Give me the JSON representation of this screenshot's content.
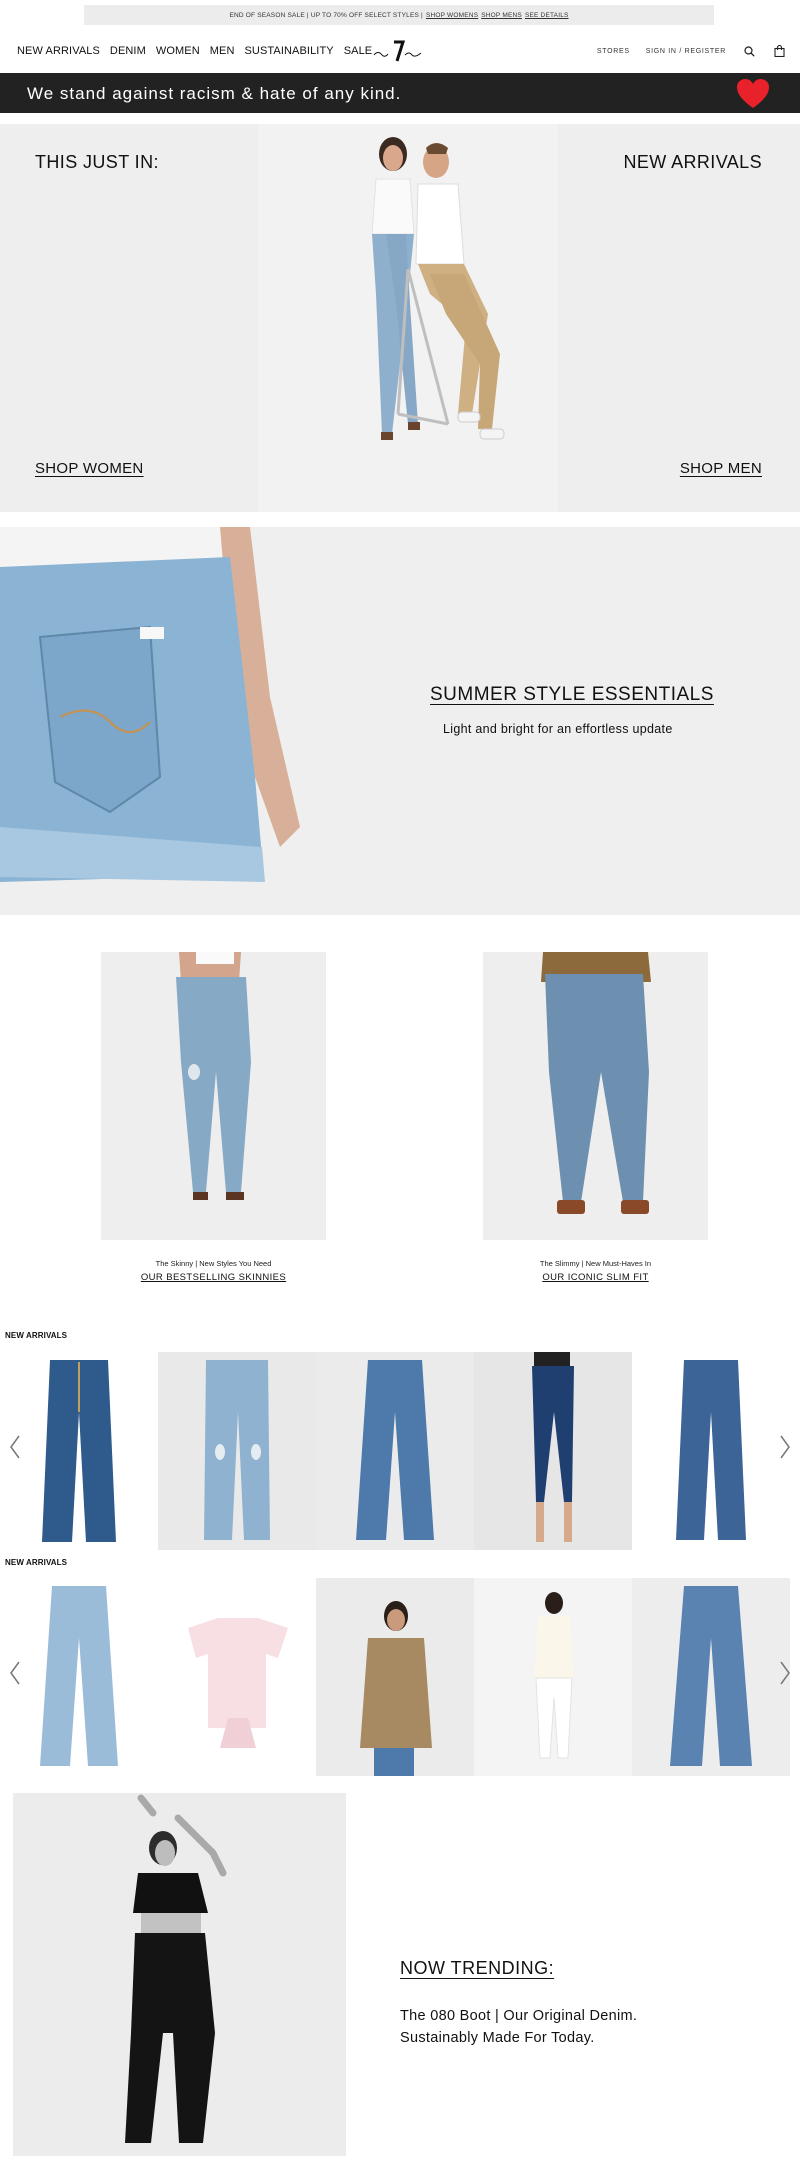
{
  "promo": {
    "text": "END OF SEASON SALE | UP TO 70% OFF SELECT STYLES |",
    "link_women": "SHOP WOMENS",
    "link_men": "SHOP MENS",
    "link_details": "SEE DETAILS"
  },
  "nav": {
    "items": [
      "NEW ARRIVALS",
      "DENIM",
      "WOMEN",
      "MEN",
      "SUSTAINABILITY",
      "SALE"
    ],
    "stores": "STORES",
    "signin": "SIGN IN / REGISTER"
  },
  "banner": {
    "text": "We stand against racism & hate of any kind."
  },
  "hero": {
    "left_title": "THIS JUST IN:",
    "right_title": "NEW ARRIVALS",
    "shop_women": "SHOP WOMEN",
    "shop_men": "SHOP MEN"
  },
  "summer": {
    "heading": "SUMMER STYLE ESSENTIALS",
    "subheading": "Light and bright for an effortless update"
  },
  "features": [
    {
      "caption": "The Skinny | New Styles You Need",
      "link": "OUR BESTSELLING SKINNIES"
    },
    {
      "caption": "The Slimmy | New Must-Haves In",
      "link": "OUR ICONIC SLIM FIT"
    }
  ],
  "carousel1": {
    "label": "NEW ARRIVALS"
  },
  "carousel2": {
    "label": "NEW ARRIVALS"
  },
  "trending": {
    "heading": "NOW TRENDING:",
    "line1": "The 080 Boot | Our Original Denim.",
    "line2": "Sustainably Made For Today."
  },
  "colors": {
    "banner_bg": "#222222",
    "heart": "#e8212b",
    "hero_bg": "#eeeeee"
  }
}
